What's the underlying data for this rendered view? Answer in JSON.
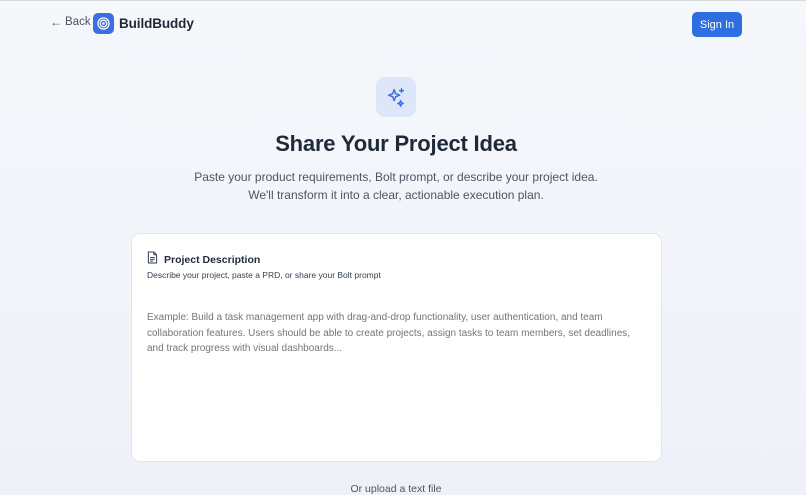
{
  "header": {
    "back_label": "Back",
    "brand_name": "BuildBuddy",
    "sign_in_label": "Sign In"
  },
  "hero": {
    "icon": "sparkles-icon",
    "title": "Share Your Project Idea",
    "subtitle": "Paste your product requirements, Bolt prompt, or describe your project idea. We'll transform it into a clear, actionable execution plan."
  },
  "card": {
    "icon": "document-icon",
    "title": "Project Description",
    "description": "Describe your project, paste a PRD, or share your Bolt prompt",
    "input_value": "",
    "placeholder": "Example: Build a task management app with drag-and-drop functionality, user authentication, and team collaboration features. Users should be able to create projects, assign tasks to team members, set deadlines, and track progress with visual dashboards..."
  },
  "upload": {
    "label": "Or upload a text file"
  },
  "colors": {
    "accent": "#2f6ee0",
    "hero_icon_bg": "#dde7f9",
    "page_bg": "#f3f6fa"
  }
}
